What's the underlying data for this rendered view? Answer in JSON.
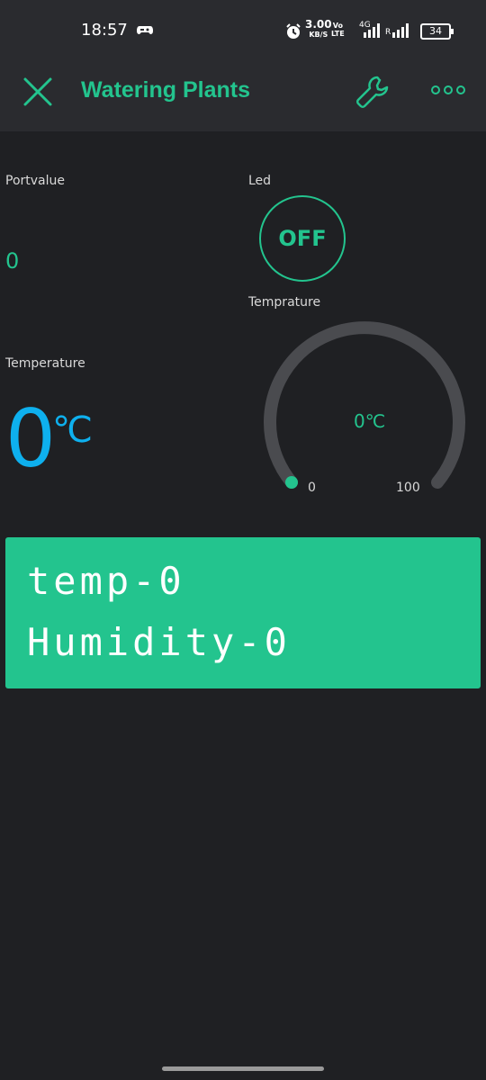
{
  "status_bar": {
    "time": "18:57",
    "net_speed": "3.00",
    "net_speed_unit": "KB/S",
    "volte": "Vo",
    "lte": "LTE",
    "network": "4G",
    "roaming": "R",
    "battery": "34"
  },
  "app_bar": {
    "title": "Watering Plants",
    "close_icon": "close-icon",
    "settings_icon": "wrench-icon",
    "more_icon": "more-icon",
    "accent": "#23c48e"
  },
  "widgets": {
    "portvalue": {
      "label": "Portvalue",
      "value": "0"
    },
    "led": {
      "label": "Led",
      "state": "OFF"
    },
    "temperature": {
      "label": "Temperature",
      "value": "0",
      "unit": "℃",
      "color": "#0eb0ee"
    },
    "gauge": {
      "label": "Temprature",
      "value": "0℃",
      "min": "0",
      "max": "100",
      "level": 0
    },
    "lcd": {
      "line1": "temp-0",
      "line2": "Humidity-0",
      "background": "#23c48e"
    }
  }
}
